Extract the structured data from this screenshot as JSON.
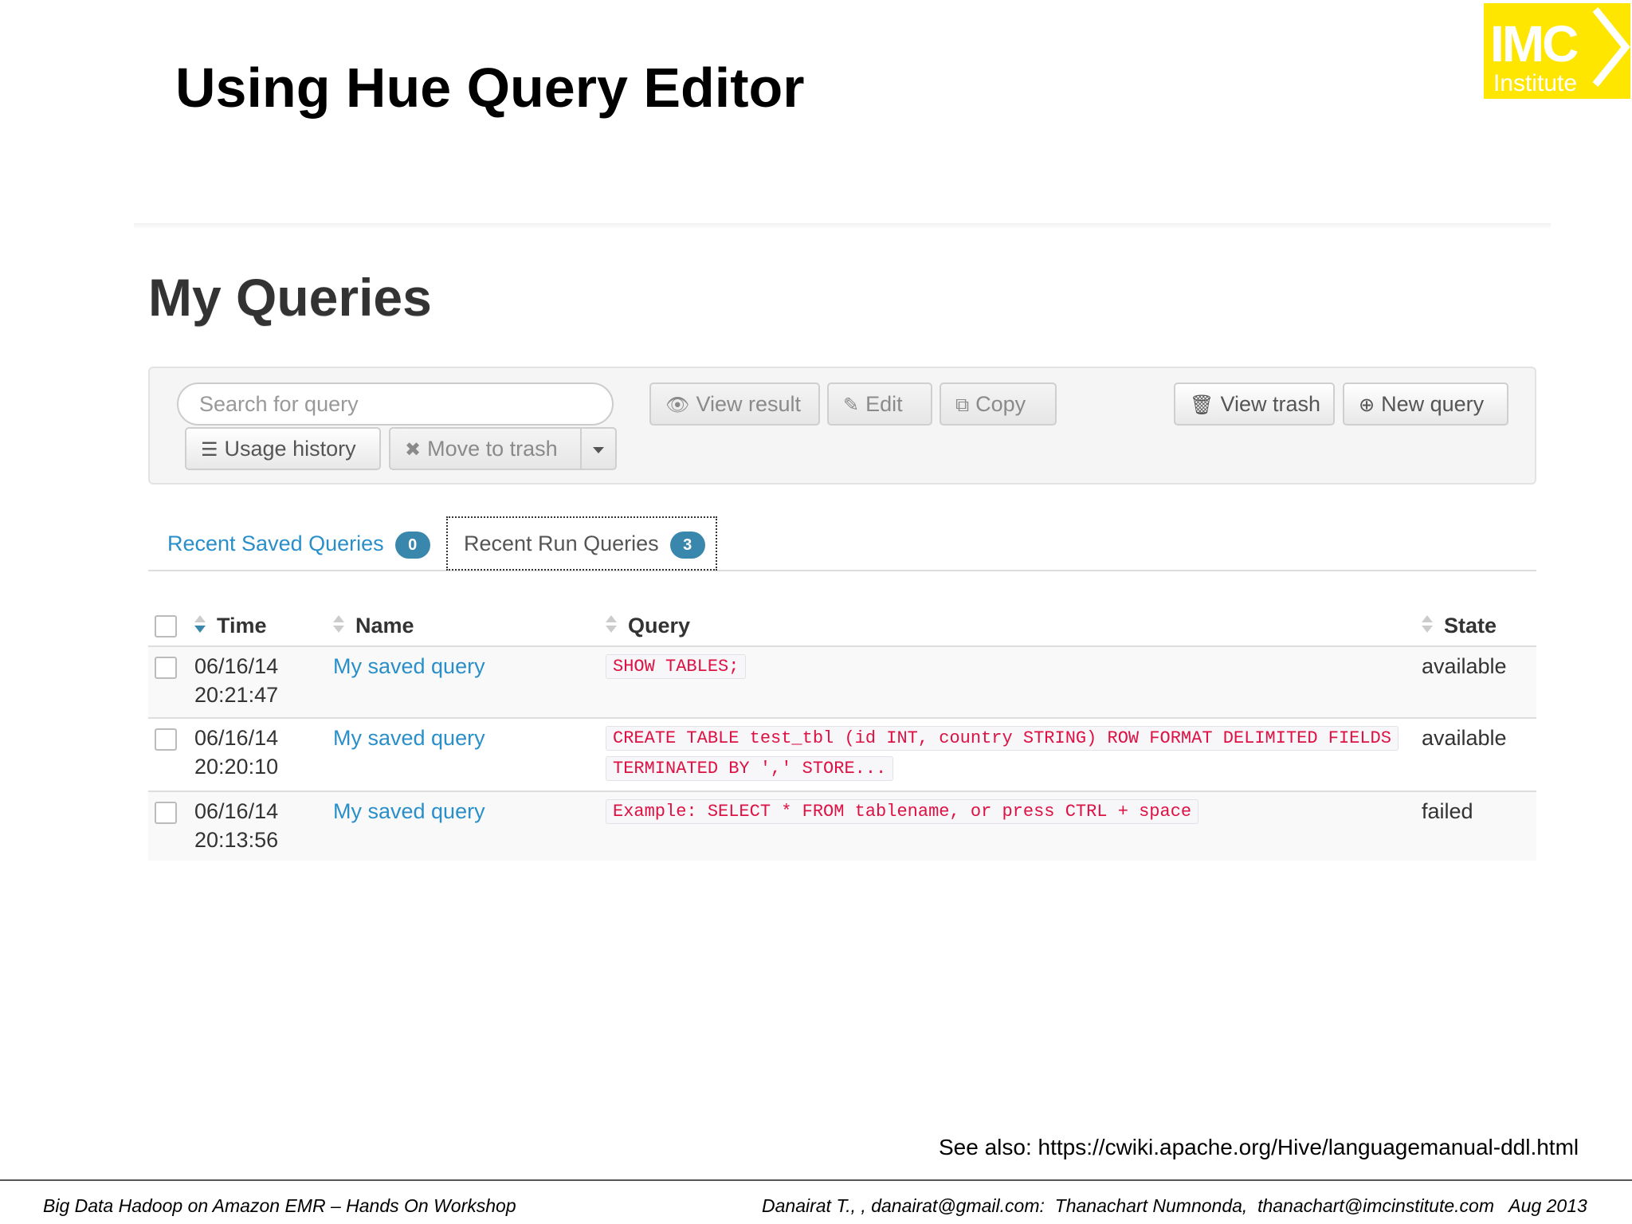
{
  "slide": {
    "title": "Using Hue Query Editor",
    "logo": {
      "main": "IMC",
      "sub": "Institute",
      "color": "#ffe600"
    },
    "see_also": "See also: https://cwiki.apache.org/Hive/languagemanual-ddl.html",
    "footer_left": "Big Data Hadoop on Amazon EMR – Hands On Workshop",
    "footer_right": "Danairat T., , danairat@gmail.com:  Thanachart Numnonda,  thanachart@imcinstitute.com   Aug 2013"
  },
  "page": {
    "heading": "My Queries"
  },
  "toolbar": {
    "search_placeholder": "Search for query",
    "usage_history": "Usage history",
    "move_to_trash": "Move to trash",
    "view_result": "View result",
    "edit": "Edit",
    "copy": "Copy",
    "view_trash": "View trash",
    "new_query": "New query"
  },
  "tabs": [
    {
      "label": "Recent Saved Queries",
      "count": "0",
      "active": false
    },
    {
      "label": "Recent Run Queries",
      "count": "3",
      "active": true
    }
  ],
  "table": {
    "columns": {
      "time": "Time",
      "name": "Name",
      "query": "Query",
      "state": "State"
    },
    "rows": [
      {
        "date": "06/16/14",
        "time": "20:21:47",
        "name": "My saved query",
        "query": "SHOW TABLES;",
        "state": "available"
      },
      {
        "date": "06/16/14",
        "time": "20:20:10",
        "name": "My saved query",
        "query_line1": "CREATE TABLE test_tbl (id INT, country STRING) ROW FORMAT DELIMITED FIELDS",
        "query_line2": "TERMINATED BY ',' STORE...",
        "state": "available"
      },
      {
        "date": "06/16/14",
        "time": "20:13:56",
        "name": "My saved query",
        "query": "Example: SELECT * FROM tablename, or press CTRL + space",
        "state": "failed"
      }
    ]
  },
  "colors": {
    "accent": "#2a8fc8",
    "badge": "#3a87ad",
    "code": "#dd1144"
  }
}
